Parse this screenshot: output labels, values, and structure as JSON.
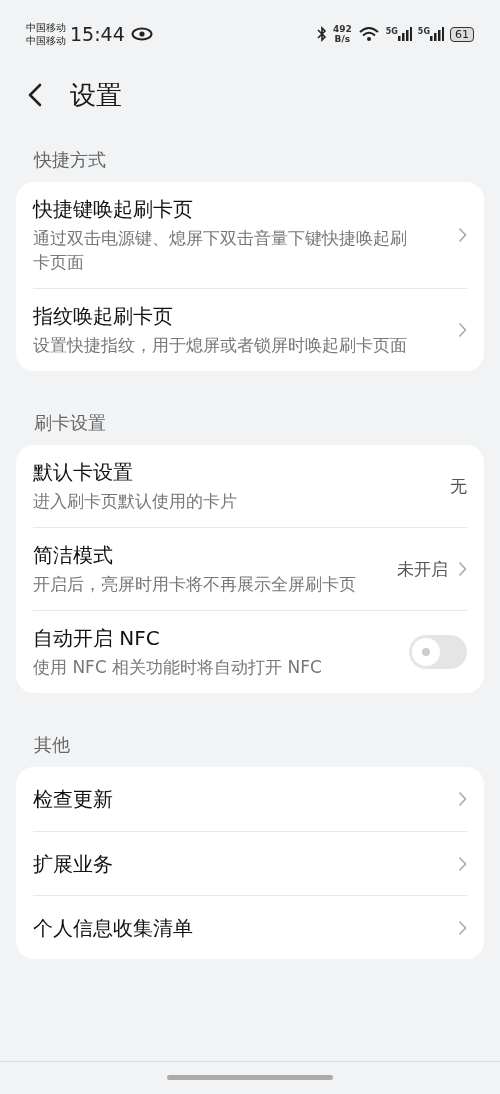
{
  "status_bar": {
    "carriers": [
      "中国移动",
      "中国移动"
    ],
    "time": "15:44",
    "speed": [
      "492",
      "B/s"
    ],
    "signals": [
      "5G",
      "5G"
    ],
    "battery": "61"
  },
  "header": {
    "title": "设置"
  },
  "sections": [
    {
      "title": "快捷方式",
      "items": [
        {
          "kind": "link",
          "title": "快捷键唤起刷卡页",
          "subtitle": "通过双击电源键、熄屏下双击音量下键快捷唤起刷卡页面"
        },
        {
          "kind": "link",
          "title": "指纹唤起刷卡页",
          "subtitle": "设置快捷指纹，用于熄屏或者锁屏时唤起刷卡页面"
        }
      ]
    },
    {
      "title": "刷卡设置",
      "items": [
        {
          "kind": "value",
          "title": "默认卡设置",
          "subtitle": "进入刷卡页默认使用的卡片",
          "value": "无"
        },
        {
          "kind": "value-link",
          "title": "简洁模式",
          "subtitle": "开启后，亮屏时用卡将不再展示全屏刷卡页",
          "value": "未开启"
        },
        {
          "kind": "switch",
          "title": "自动开启 NFC",
          "subtitle": "使用 NFC 相关功能时将自动打开 NFC",
          "on": false
        }
      ]
    },
    {
      "title": "其他",
      "items": [
        {
          "kind": "link",
          "title": "检查更新"
        },
        {
          "kind": "link",
          "title": "扩展业务"
        },
        {
          "kind": "link",
          "title": "个人信息收集清单"
        }
      ]
    }
  ]
}
